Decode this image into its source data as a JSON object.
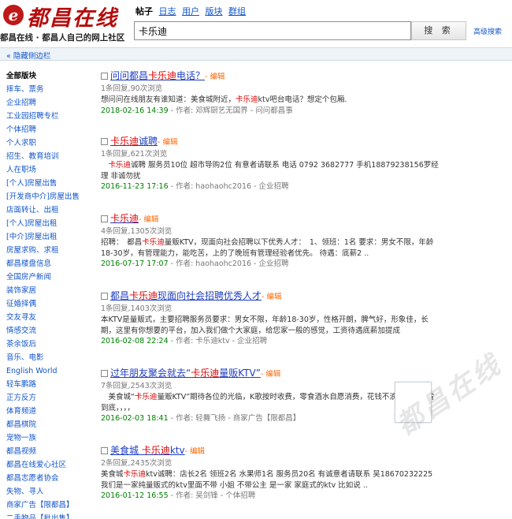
{
  "header": {
    "logo_text": "都昌在线",
    "slogan": "都昌在线 · 都昌人自己的网上社区",
    "nav": [
      {
        "label": "帖子",
        "active": true
      },
      {
        "label": "日志",
        "active": false
      },
      {
        "label": "用户",
        "active": false
      },
      {
        "label": "版块",
        "active": false
      },
      {
        "label": "群组",
        "active": false
      }
    ],
    "search_value": "卡乐迪",
    "search_button": "搜 索",
    "advanced_search": "高级搜索"
  },
  "toggle_sidebar": "« 隐藏侧边栏",
  "sidebar": {
    "items": [
      "全部版块",
      "摔车、票务",
      "企业招聘",
      "工业园招聘专栏",
      "个体招聘",
      "个人求职",
      "招生、教育培训",
      "人在职场",
      "[个人]房屋出售",
      "[开发商中介]房屋出售",
      "店面转让、出租",
      "[个人]房屋出租",
      "[中介]房屋出租",
      "房屋求购、求租",
      "都昌楼盘信息",
      "全国房产新闻",
      "装饰家居",
      "征婚择偶",
      "交友寻友",
      "情感交流",
      "茶余饭后",
      "音乐、电影",
      "English World",
      "轻车鹏路",
      "正方反方",
      "体育频道",
      "都昌棋院",
      "宠物一族",
      "都昌视频",
      "都昌在线爱心社区",
      "都昌志愿者协会",
      "失物、寻人",
      "商家广告【限都昌】",
      "二手物品【批出售】"
    ]
  },
  "results": [
    {
      "title": [
        {
          "t": "问问都昌",
          "h": false
        },
        {
          "t": "卡乐迪",
          "h": true
        },
        {
          "t": "电话？",
          "h": false
        }
      ],
      "edit": "- 编辑",
      "meta": "1条回复,90次浏览",
      "snippet": [
        {
          "t": "想问问在线朋友有谁知道：美食城附近，",
          "h": false
        },
        {
          "t": "卡乐迪",
          "h": true
        },
        {
          "t": "ktv吧台电话？想定个包厢.",
          "h": false
        }
      ],
      "time": "2018-02-16 14:39",
      "footer": " - 作者: 邓辉厨艺无国界 - 问问都昌事"
    },
    {
      "title": [
        {
          "t": "卡乐迪",
          "h": true
        },
        {
          "t": "诚聘",
          "h": false
        }
      ],
      "edit": "- 编辑",
      "meta": "1条回复,621次浏览",
      "snippet": [
        {
          "t": "　",
          "h": false
        },
        {
          "t": "卡乐迪",
          "h": true
        },
        {
          "t": "诚聘 服务员10位 超市导购2位 有意者请联系 电话 0792 3682777 手机18879238156罗经理 非诚勿扰",
          "h": false
        }
      ],
      "time": "2016-11-23 17:16",
      "footer": " - 作者: haohaohc2016 - 企业招聘"
    },
    {
      "title": [
        {
          "t": "卡乐迪",
          "h": true
        }
      ],
      "edit": "- 编辑",
      "meta": "4条回复,1305次浏览",
      "snippet": [
        {
          "t": "招聘：　都昌",
          "h": false
        },
        {
          "t": "卡乐迪",
          "h": true
        },
        {
          "t": "量贩KTV，现面向社会招聘以下优秀人才：　1、领班：1名 要求：男女不限，年龄18-30岁，有管理能力，能吃苦，上的了晚班有管理经验者优先。 待遇：底薪2 ..",
          "h": false
        }
      ],
      "time": "2016-07-17 17:07",
      "footer": " - 作者: haohaohc2016 - 企业招聘"
    },
    {
      "title": [
        {
          "t": "都昌",
          "h": false
        },
        {
          "t": "卡乐迪",
          "h": true
        },
        {
          "t": "现面向社会招聘优秀人才",
          "h": false
        }
      ],
      "edit": "- 编辑",
      "meta": "1条回复,1403次浏览",
      "snippet": [
        {
          "t": "本KTV是量贩式，主要招聘服务员要求：男女不限，年龄18-30岁，性格开朗，脾气好，形象佳，长期，这里有你想要的平台，加入我们做个大家庭，给您家一般的感觉，工资待遇底薪加提成",
          "h": false
        }
      ],
      "time": "2016-02-08 22:24",
      "footer": " - 作者: 卡乐迪ktv - 企业招聘"
    },
    {
      "title": [
        {
          "t": "过年朋友聚会就去“",
          "h": false
        },
        {
          "t": "卡乐迪",
          "h": true
        },
        {
          "t": "量贩KTV”",
          "h": false
        }
      ],
      "edit": "- 编辑",
      "meta": "7条回复,2543次浏览",
      "snippet": [
        {
          "t": "　美食城“",
          "h": false
        },
        {
          "t": "卡乐迪",
          "h": true
        },
        {
          "t": "量贩KTV”期待各位的光临，K歌按时收费，零食酒水自愿消费，花钱不浪费，为你省到底，，，，",
          "h": false
        }
      ],
      "time": "2016-02-03 18:41",
      "footer": " - 作者: 轻舞飞扬 - 商家广告【限都昌】"
    },
    {
      "title": [
        {
          "t": "美食城 ",
          "h": false
        },
        {
          "t": "卡乐迪",
          "h": true
        },
        {
          "t": "ktv",
          "h": false
        }
      ],
      "edit": "- 编辑",
      "meta": "2条回复,2435次浏览",
      "snippet": [
        {
          "t": "美食城",
          "h": false
        },
        {
          "t": "卡乐迪",
          "h": true
        },
        {
          "t": "ktv诚聘：店长2名 领班2名 水果师1名 服务员20名 有诚意者请联系 吴18670232225 我们是一家纯量贩式的ktv里面不带 小姐 不带公主 是一家 家庭式的ktv 比如说 ..",
          "h": false
        }
      ],
      "time": "2016-01-12 16:55",
      "footer": " - 作者: 吴剑锋 - 个体招聘"
    }
  ],
  "watermark": "都昌在线",
  "colors": {
    "brand_red": "#b50d0d",
    "highlight": "#dd0000",
    "link_blue": "#1f3ec2",
    "timestamp_green": "#008000"
  }
}
